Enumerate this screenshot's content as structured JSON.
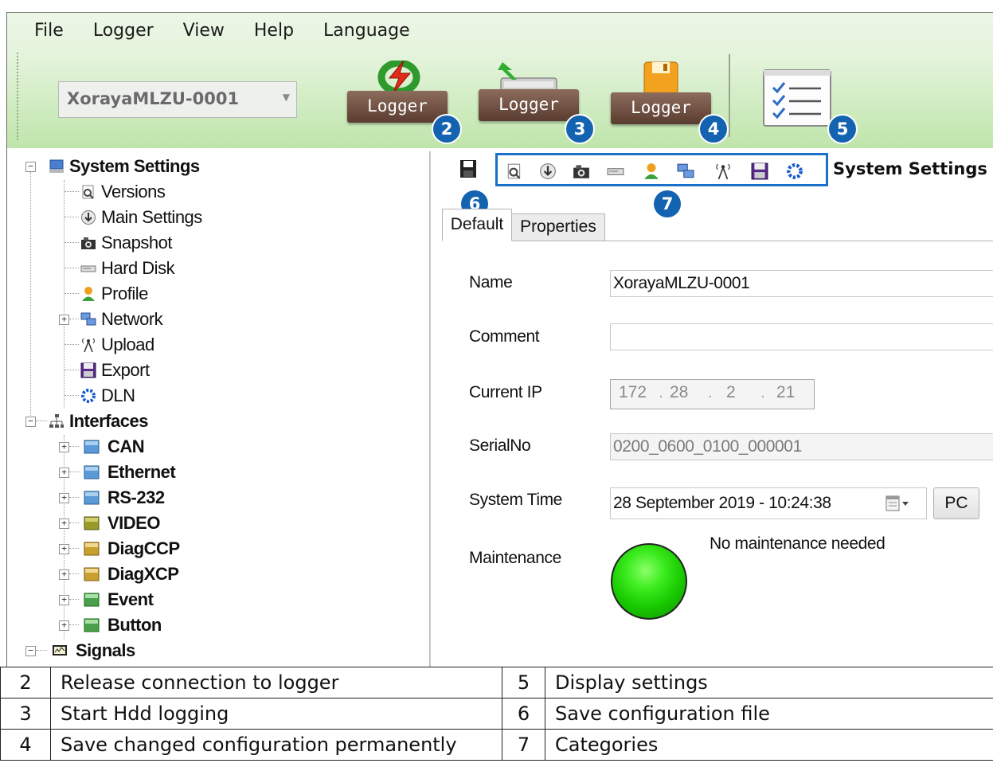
{
  "menu": [
    "File",
    "Logger",
    "View",
    "Help",
    "Language"
  ],
  "device_combo": {
    "value": "XorayaMLZU-0001"
  },
  "toolbar": {
    "release_label": "Logger",
    "hdd_label": "Logger",
    "save_label": "Logger"
  },
  "badges": {
    "b2": "2",
    "b3": "3",
    "b4": "4",
    "b5": "5",
    "b6": "6",
    "b7": "7"
  },
  "tree": {
    "system_settings": "System Settings",
    "versions": "Versions",
    "main_settings": "Main Settings",
    "snapshot": "Snapshot",
    "hard_disk": "Hard Disk",
    "profile": "Profile",
    "network": "Network",
    "upload": "Upload",
    "export": "Export",
    "dln": "DLN",
    "interfaces": "Interfaces",
    "can": "CAN",
    "ethernet": "Ethernet",
    "rs232": "RS-232",
    "video": "VIDEO",
    "diagccp": "DiagCCP",
    "diagxcp": "DiagXCP",
    "event": "Event",
    "button": "Button",
    "signals": "Signals"
  },
  "panel_title": "System Settings",
  "tabs": {
    "default": "Default",
    "properties": "Properties"
  },
  "form": {
    "name_label": "Name",
    "name_value": "XorayaMLZU-0001",
    "comment_label": "Comment",
    "comment_value": "",
    "ip_label": "Current IP",
    "ip": [
      "172",
      "28",
      "2",
      "21"
    ],
    "serial_label": "SerialNo",
    "serial_value": "0200_0600_0100_000001",
    "time_label": "System Time",
    "time_value": "28 September 2019 - 10:24:38",
    "pc_label": "PC",
    "maintenance_label": "Maintenance",
    "maintenance_text": "No maintenance needed"
  },
  "legend": [
    {
      "n1": "2",
      "t1": "Release connection to logger",
      "n2": "5",
      "t2": "Display settings"
    },
    {
      "n1": "3",
      "t1": "Start Hdd logging",
      "n2": "6",
      "t2": "Save configuration file"
    },
    {
      "n1": "4",
      "t1": "Save changed configuration permanently",
      "n2": "7",
      "t2": "Categories"
    }
  ]
}
